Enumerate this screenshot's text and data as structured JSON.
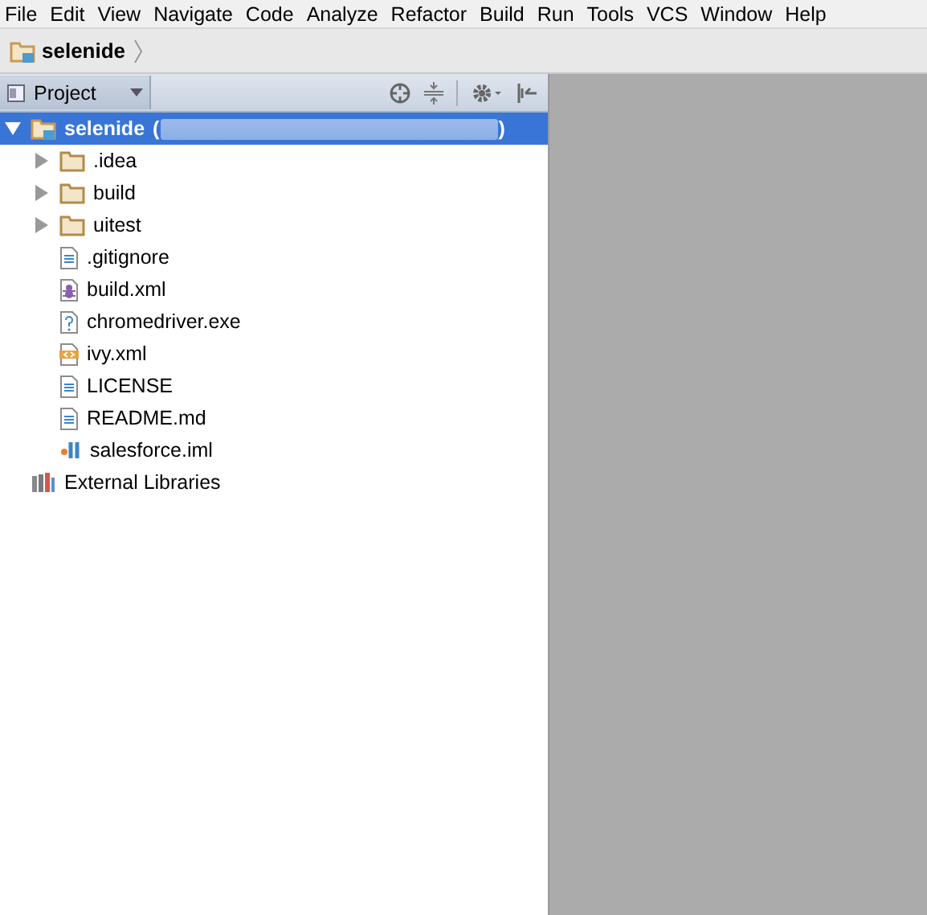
{
  "menu": [
    "File",
    "Edit",
    "View",
    "Navigate",
    "Code",
    "Analyze",
    "Refactor",
    "Build",
    "Run",
    "Tools",
    "VCS",
    "Window",
    "Help"
  ],
  "breadcrumb": {
    "label": "selenide"
  },
  "panel": {
    "view": "Project"
  },
  "tree": [
    {
      "label": "selenide",
      "suffix_open": "(",
      "suffix_close": ")",
      "kind": "module",
      "expanded": true,
      "selected": true,
      "children": [
        {
          "label": ".idea",
          "kind": "folder",
          "expanded": false,
          "selected": false
        },
        {
          "label": "build",
          "kind": "folder",
          "expanded": false,
          "selected": false
        },
        {
          "label": "uitest",
          "kind": "folder",
          "expanded": false,
          "selected": false
        },
        {
          "label": ".gitignore",
          "kind": "text",
          "selected": false
        },
        {
          "label": "build.xml",
          "kind": "ant",
          "selected": false
        },
        {
          "label": "chromedriver.exe",
          "kind": "unknown",
          "selected": false
        },
        {
          "label": "ivy.xml",
          "kind": "xml",
          "selected": false
        },
        {
          "label": "LICENSE",
          "kind": "text",
          "selected": false
        },
        {
          "label": "README.md",
          "kind": "text",
          "selected": false
        },
        {
          "label": "salesforce.iml",
          "kind": "iml",
          "selected": false
        }
      ]
    },
    {
      "label": "External Libraries",
      "kind": "library",
      "selected": false
    }
  ]
}
